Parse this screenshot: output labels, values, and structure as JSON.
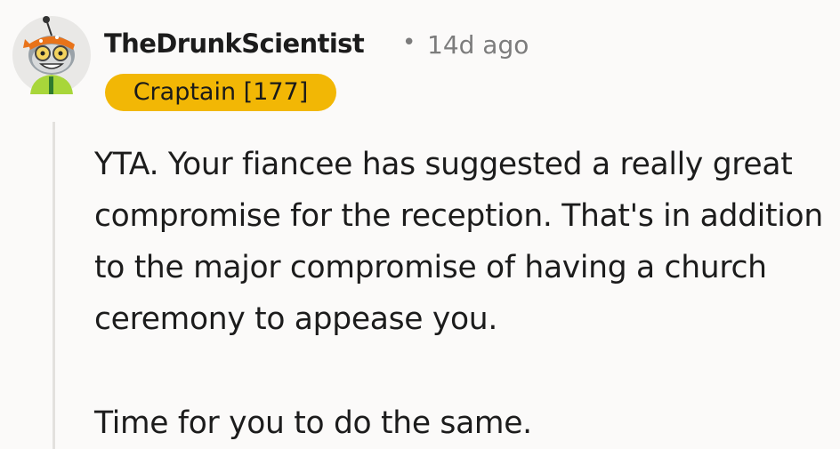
{
  "comment": {
    "author": "TheDrunkScientist",
    "separator": "•",
    "timestamp": "14d ago",
    "flair": "Craptain [177]",
    "flair_color": "#f2b705",
    "avatar_icon": "snoo-avatar-icon",
    "paragraphs": [
      "YTA. Your fiancee has suggested a really great compromise for the reception. That's in addition to the major compromise of having a church ceremony to appease you.",
      "Time for you to do the same."
    ]
  }
}
